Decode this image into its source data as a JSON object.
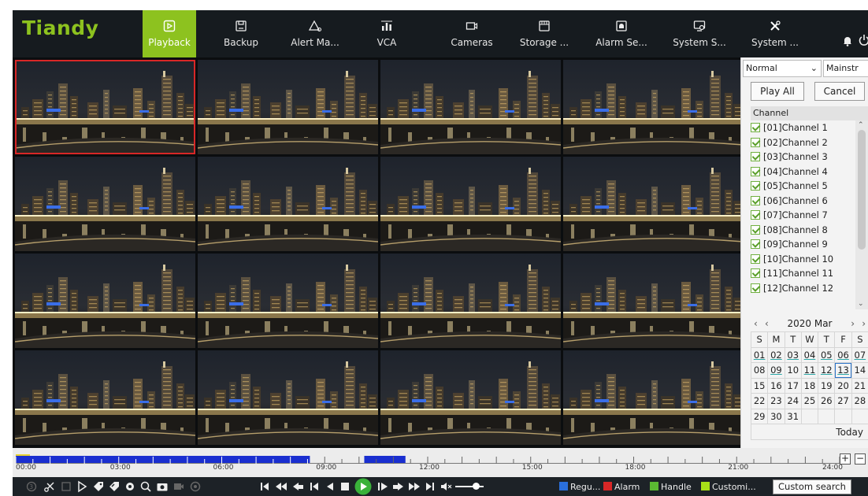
{
  "brand": {
    "logo": "Tiandy",
    "accent": "#8dc21f"
  },
  "nav": [
    {
      "label": "Playback",
      "icon": "playback-icon",
      "active": true
    },
    {
      "label": "Backup",
      "icon": "save-icon"
    },
    {
      "label": "Alert Ma...",
      "icon": "alert-icon"
    },
    {
      "label": "VCA",
      "icon": "vca-icon"
    },
    {
      "label": "Cameras",
      "icon": "camera-icon"
    },
    {
      "label": "Storage ...",
      "icon": "storage-icon"
    },
    {
      "label": "Alarm Se...",
      "icon": "alarm-settings-icon"
    },
    {
      "label": "System S...",
      "icon": "system-settings-icon"
    },
    {
      "label": "System ...",
      "icon": "system-tools-icon"
    }
  ],
  "side": {
    "stream_mode": "Normal",
    "stream_type": "Mainstr",
    "play_all": "Play All",
    "cancel": "Cancel",
    "channel_header": "Channel",
    "channels": [
      "[01]Channel 1",
      "[02]Channel 2",
      "[03]Channel 3",
      "[04]Channel 4",
      "[05]Channel 5",
      "[06]Channel 6",
      "[07]Channel 7",
      "[08]Channel 8",
      "[09]Channel 9",
      "[10]Channel 10",
      "[11]Channel 11",
      "[12]Channel 12"
    ]
  },
  "calendar": {
    "month_label": "2020 Mar",
    "weekdays": [
      "S",
      "M",
      "T",
      "W",
      "T",
      "F",
      "S"
    ],
    "weeks": [
      [
        "01",
        "02",
        "03",
        "04",
        "05",
        "06",
        "07"
      ],
      [
        "08",
        "09",
        "10",
        "11",
        "12",
        "13",
        "14"
      ],
      [
        "15",
        "16",
        "17",
        "18",
        "19",
        "20",
        "21"
      ],
      [
        "22",
        "23",
        "24",
        "25",
        "26",
        "27",
        "28"
      ],
      [
        "29",
        "30",
        "31",
        "",
        "",
        "",
        ""
      ]
    ],
    "recorded_days": [
      "01",
      "02",
      "03",
      "04",
      "05",
      "06",
      "07",
      "09",
      "11",
      "12",
      "13"
    ],
    "selected_day": "13",
    "today_label": "Today"
  },
  "timeline": {
    "labels": [
      "00:00",
      "03:00",
      "06:00",
      "09:00",
      "12:00",
      "15:00",
      "18:00",
      "21:00",
      "24:00"
    ],
    "recording_color": "#1a2fd0"
  },
  "legend": [
    {
      "label": "Regu...",
      "color": "#2a6fdc"
    },
    {
      "label": "Alarm",
      "color": "#d82727"
    },
    {
      "label": "Handle",
      "color": "#5bb832"
    },
    {
      "label": "Customi...",
      "color": "#a8e018"
    }
  ],
  "custom_search": "Custom search"
}
